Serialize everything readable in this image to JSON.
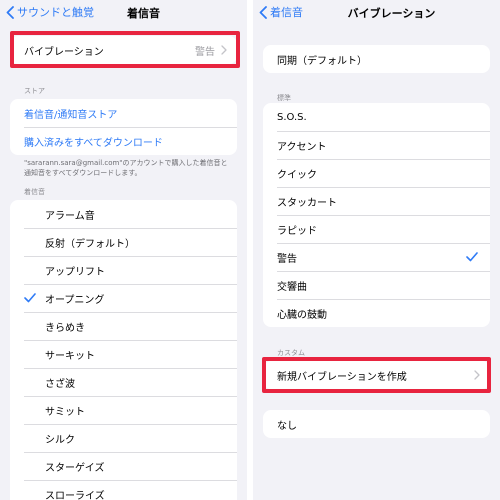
{
  "left": {
    "back_label": "サウンドと触覚",
    "title": "着信音",
    "vibration_row": {
      "label": "バイブレーション",
      "value": "警告"
    },
    "store_section": "ストア",
    "store_items": [
      "着信音/通知音ストア",
      "購入済みをすべてダウンロード"
    ],
    "store_footnote": "\"sararann.sara@gmail.com\"のアカウントで購入した着信音と通知音をすべてダウンロードします。",
    "ringtone_section": "着信音",
    "ringtones": [
      "アラーム音",
      "反射（デフォルト）",
      "アップリフト",
      "オープニング",
      "きらめき",
      "サーキット",
      "さざ波",
      "サミット",
      "シルク",
      "スターゲイズ",
      "スローライズ"
    ],
    "selected_ringtone": "オープニング"
  },
  "right": {
    "back_label": "着信音",
    "title": "バイブレーション",
    "default_item": "同期（デフォルト）",
    "standard_section": "標準",
    "standard_items": [
      "S.O.S.",
      "アクセント",
      "クイック",
      "スタッカート",
      "ラピッド",
      "警告",
      "交響曲",
      "心臓の鼓動"
    ],
    "selected_item": "警告",
    "custom_section": "カスタム",
    "custom_item": "新規バイブレーションを作成",
    "none_item": "なし"
  },
  "colors": {
    "accent_blue": "#2f7bf6",
    "highlight_red": "#e8243f",
    "background": "#f2f2f7"
  },
  "icons": [
    "chevron-left-icon",
    "chevron-right-icon",
    "checkmark-icon"
  ]
}
